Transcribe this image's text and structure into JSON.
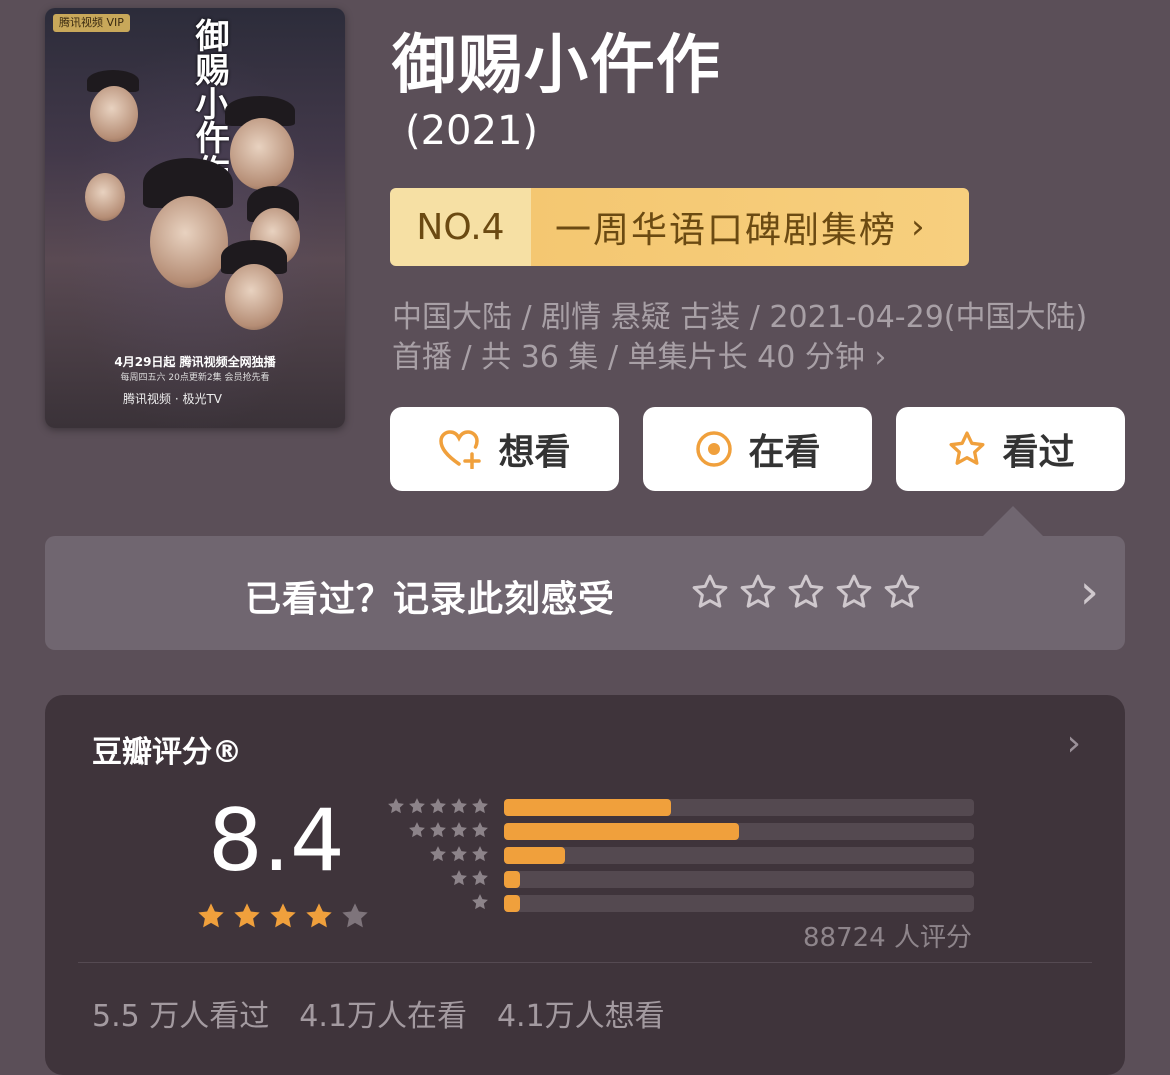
{
  "poster": {
    "badge": "腾讯视频 VIP",
    "title": "御赐小仵作",
    "air_text": "4月29日起 腾讯视频全网独播",
    "sub_text": "每周四五六 20点更新2集 会员抢先看",
    "logos": "腾讯视频 · 极光TV"
  },
  "title": "御赐小仵作",
  "year": "(2021)",
  "rank": {
    "number": "NO.4",
    "name": "一周华语口碑剧集榜",
    "chevron": "›"
  },
  "meta": {
    "text": "中国大陆 / 剧情 悬疑 古装 / 2021-04-29(中国大陆) 首播 / 共 36 集 / 单集片长 40 分钟",
    "chevron": "›"
  },
  "buttons": {
    "want": "想看",
    "doing": "在看",
    "done": "看过"
  },
  "rate_prompt": {
    "text": "已看过？记录此刻感受",
    "chevron": "›"
  },
  "rating": {
    "label": "豆瓣评分®",
    "chevron": "›",
    "score": "8.4",
    "stars": 4,
    "distribution": [
      {
        "stars": 5,
        "fraction": 0.355
      },
      {
        "stars": 4,
        "fraction": 0.5
      },
      {
        "stars": 3,
        "fraction": 0.13
      },
      {
        "stars": 2,
        "fraction": 0.035
      },
      {
        "stars": 1,
        "fraction": 0.035
      }
    ],
    "raters": "88724 人评分"
  },
  "counts": {
    "watched": "5.5 万人看过",
    "watching": "4.1万人在看",
    "want": "4.1万人想看"
  },
  "colors": {
    "accent": "#f0a03c",
    "background": "#5b4f58",
    "card": "#3f343b"
  }
}
